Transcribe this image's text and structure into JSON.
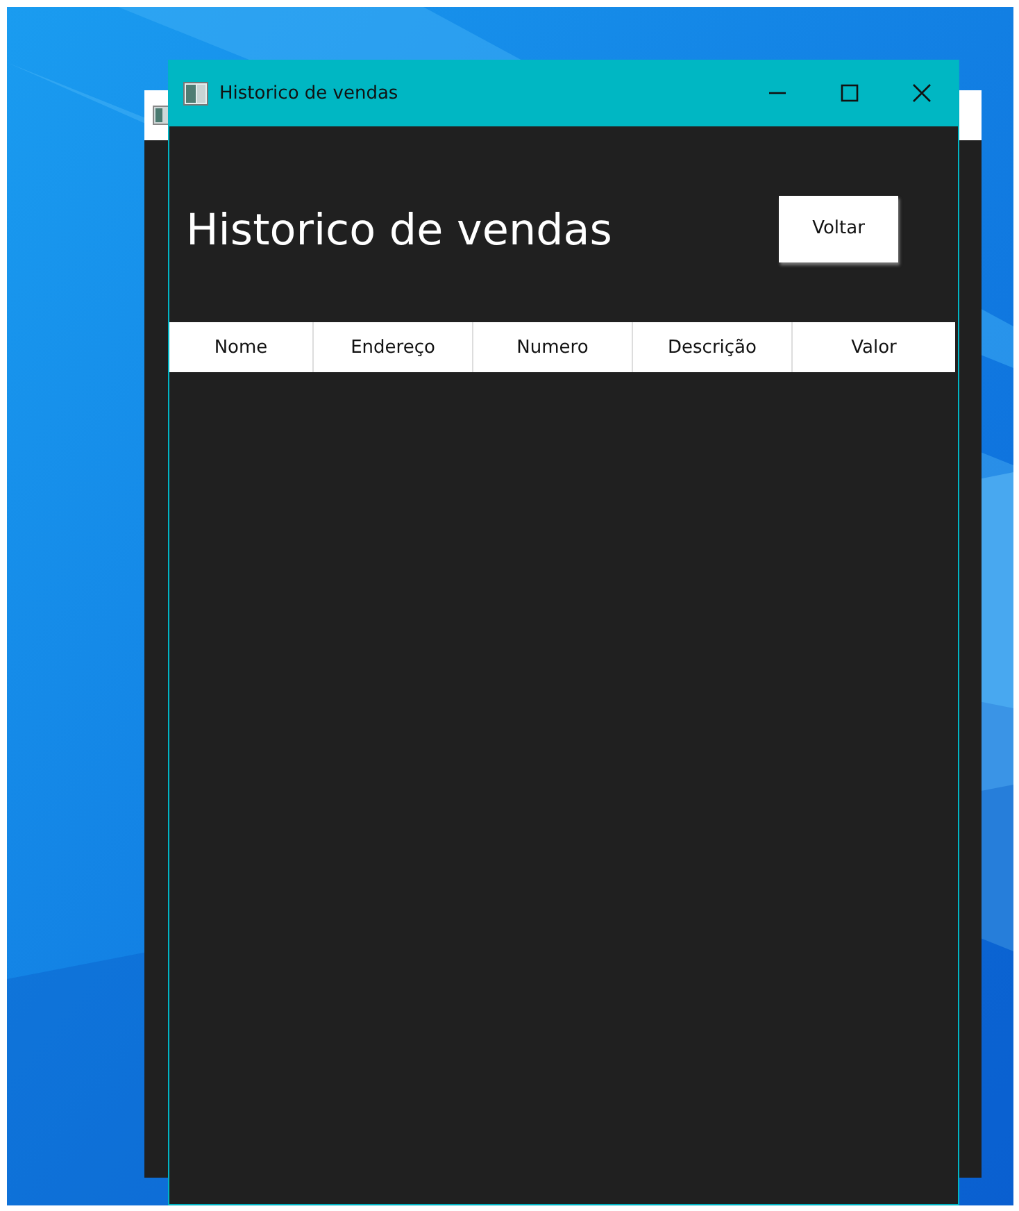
{
  "window": {
    "title": "Historico de vendas"
  },
  "heading": "Historico de vendas",
  "back_button": "Voltar",
  "table": {
    "columns": [
      "Nome",
      "Endereço",
      "Numero",
      "Descrição",
      "Valor"
    ]
  }
}
